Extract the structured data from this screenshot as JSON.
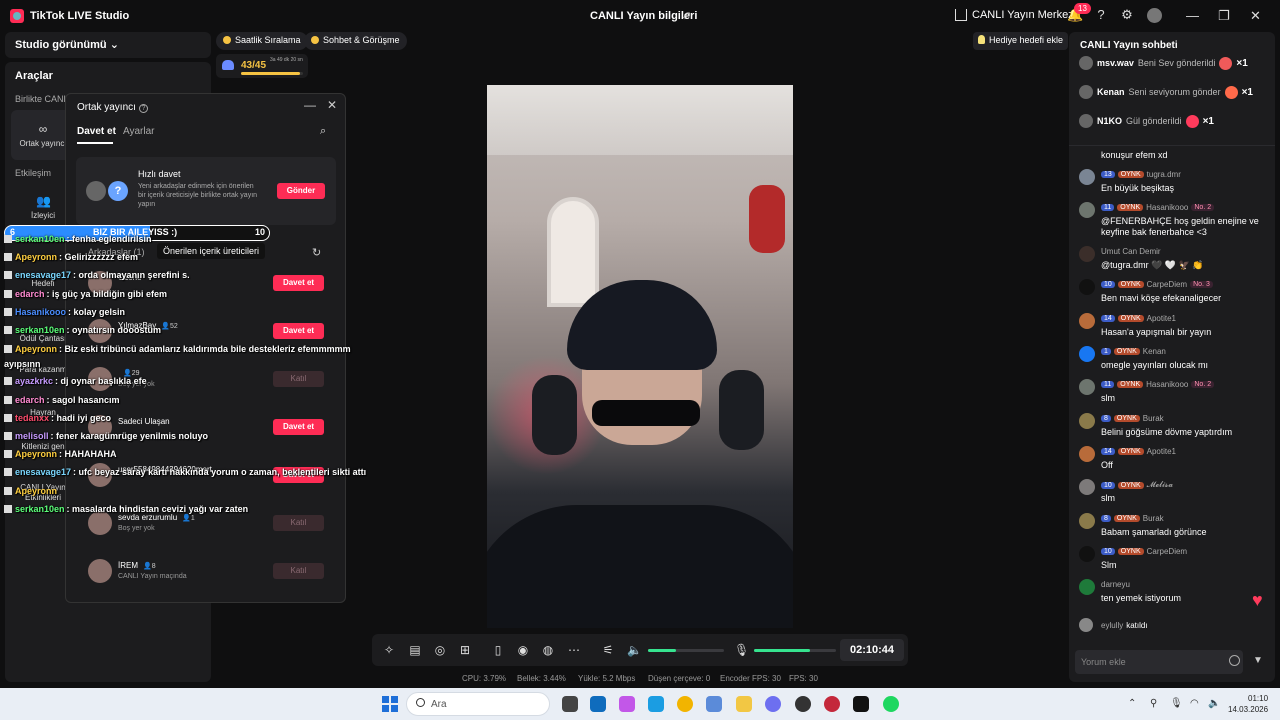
{
  "titlebar": {
    "app_title": "TikTok LIVE Studio",
    "center_title": "CANLI Yayın bilgileri",
    "live_center": "CANLI Yayın Merkezi",
    "notification_count": "13"
  },
  "left": {
    "studio_view": "Studio görünümü",
    "tools_title": "Araçlar",
    "section_together": "Birlikte CANLI",
    "cohost_label": "Ortak yayıncı",
    "section_interaction": "Etkileşim",
    "viewers_label": "İzleyici",
    "items": [
      "Hedefi",
      "Ödül Çantası",
      "Para kazanm",
      "Hayran",
      "Kitlenizi gen",
      "CANLI Yayın",
      "Etkinlikleri"
    ]
  },
  "pills": {
    "hourly_ranking": "Saatlik Sıralama",
    "chat_meet": "Sohbet & Görüşme",
    "gift_goal": "Hediye hedefi ekle"
  },
  "goal": {
    "value": "43/45",
    "timer": "3a 49 dk 20 sn",
    "progress": 0.95
  },
  "popup": {
    "title": "Ortak yayıncı",
    "tab_invite": "Davet et",
    "tab_settings": "Ayarlar",
    "quick_title": "Hızlı davet",
    "quick_desc": "Yeni arkadaşlar edinmek için önerilen bir içerik üreticisiyle birlikte ortak yayın yapın",
    "send_label": "Gönder",
    "section_friends": "Arkadaşlar (1)",
    "section_suggested": "Önerilen içerik üreticileri",
    "rows": [
      {
        "name": "Ozone",
        "followers": "",
        "sub": "",
        "button": "Davet et",
        "active": true
      },
      {
        "name": "YılmazBay",
        "followers": "52",
        "sub": "",
        "button": "Davet et",
        "active": true
      },
      {
        "name": "",
        "followers": "29",
        "sub": "Boş yer yok",
        "button": "Katıl",
        "active": false
      },
      {
        "name": "Sadeci Ulaşan",
        "followers": "",
        "sub": "",
        "button": "Davet et",
        "active": true
      },
      {
        "name": "user55849844394620mert",
        "followers": "",
        "sub": "",
        "button": "Davet et",
        "active": true
      },
      {
        "name": "sevda erzurumlu",
        "followers": "1",
        "sub": "Boş yer yok",
        "button": "Katıl",
        "active": false
      },
      {
        "name": "İREM",
        "followers": "8",
        "sub": "CANLI Yayın maçında",
        "button": "Katıl",
        "active": false
      }
    ]
  },
  "overlay": {
    "bar_left": "6",
    "bar_mid": "BIZ BIR AILEYISS :)",
    "bar_right": "10",
    "lines": [
      {
        "user": "serkan10en",
        "text": ": fenha eglendirilsin",
        "color": "#5cff7a"
      },
      {
        "user": "Apeyronn",
        "text": ": Gelirizzzzzz efem",
        "color": "#ffcf40"
      },
      {
        "user": "enesavage17",
        "text": ": orda olmayanın şerefini s.",
        "color": "#7ad7ff"
      },
      {
        "user": "edarch",
        "text": ": iş güç ya bildiğin gibi efem",
        "color": "#ff8bd1"
      },
      {
        "user": "Hasanikooo",
        "text": ": kolay gelsin",
        "color": "#4a8dff"
      },
      {
        "user": "serkan10en",
        "text": ": oynatırsın dooostum",
        "color": "#5cff7a"
      },
      {
        "user": "Apeyronn",
        "text": ": Biz eski tribüncü adamlarız kaldırımda bile destekleriz efemmmmm",
        "color": "#ffcf40"
      },
      {
        "user": "",
        "text": "ayıpsınn",
        "color": "#ffffff"
      },
      {
        "user": "ayazkrkc",
        "text": ": dj oynar başlıkla efe",
        "color": "#c79bff"
      },
      {
        "user": "edarch",
        "text": ": sagol hasancım",
        "color": "#ff8bd1"
      },
      {
        "user": "tedanxx",
        "text": ": hadi iyi geco",
        "color": "#ff4d6d"
      },
      {
        "user": "melisoll",
        "text": ": fener karagümrüge yenilmis noluyo",
        "color": "#c79bff"
      },
      {
        "user": "Apeyronn",
        "text": ": HAHAHAHA",
        "color": "#ffcf40"
      },
      {
        "user": "enesavage17",
        "text": ": ufc beyaz saray kartı hakkında yorum o zaman, beklentileri sikti attı",
        "color": "#7ad7ff"
      },
      {
        "user": "Apeyronn",
        "text": "",
        "color": "#ffcf40"
      },
      {
        "user": "serkan10en",
        "text": ": masalarda hindistan cevizi yağı var zaten",
        "color": "#5cff7a"
      }
    ]
  },
  "chat": {
    "title": "CANLI Yayın sohbeti",
    "gifts": [
      {
        "user": "msv.wav",
        "text": "Beni Sev gönderildi",
        "count": "×1",
        "color": "#f05a5a"
      },
      {
        "user": "Kenan",
        "text": "Seni seviyorum gönder",
        "count": "×1",
        "color": "#ff6a4a"
      },
      {
        "user": "N1KO",
        "text": "Gül gönderildi",
        "count": "×1",
        "color": "#ff3b5c"
      }
    ],
    "messages": [
      {
        "meta_user": "",
        "level": "",
        "oynk": false,
        "rank": "",
        "text": "konuşur efem xd"
      },
      {
        "meta_user": "tugra.dmr",
        "level": "13",
        "oynk": true,
        "rank": "",
        "text": "En büyük beşiktaş"
      },
      {
        "meta_user": "Hasanikooo",
        "level": "11",
        "oynk": true,
        "rank": "No. 2",
        "text": "@FENERBAHÇE hoş geldin enejine ve keyfine bak fenerbahce <3"
      },
      {
        "meta_user": "Umut Can Demir",
        "level": "",
        "oynk": false,
        "rank": "",
        "text": "@tugra.dmr 🖤 🤍 🦅 👏"
      },
      {
        "meta_user": "CarpeDiem",
        "level": "10",
        "oynk": true,
        "rank": "No. 3",
        "text": "Ben mavi köşe efekanaligecer"
      },
      {
        "meta_user": "Apotite1",
        "level": "14",
        "oynk": true,
        "rank": "",
        "text": "Hasan'a yapışmalı bir yayın"
      },
      {
        "meta_user": "Kenan",
        "level": "1",
        "oynk": true,
        "rank": "",
        "text": "omegle yayınları olucak mı"
      },
      {
        "meta_user": "Hasanikooo",
        "level": "11",
        "oynk": true,
        "rank": "No. 2",
        "text": "slm"
      },
      {
        "meta_user": "Burak",
        "level": "8",
        "oynk": true,
        "rank": "",
        "text": "Belini göğsüme dövme yaptırdım"
      },
      {
        "meta_user": "Apotite1",
        "level": "14",
        "oynk": true,
        "rank": "",
        "text": "Off"
      },
      {
        "meta_user": "𝓜𝓮𝓵𝓲𝓼𝓪",
        "level": "10",
        "oynk": true,
        "rank": "",
        "text": "slm"
      },
      {
        "meta_user": "Burak",
        "level": "8",
        "oynk": true,
        "rank": "",
        "text": "Babam şamarladı görünce"
      },
      {
        "meta_user": "CarpeDiem",
        "level": "10",
        "oynk": true,
        "rank": "",
        "text": "Slm"
      },
      {
        "meta_user": "darneyu",
        "level": "",
        "oynk": false,
        "rank": "",
        "text": "ten yemek istiyorum"
      }
    ],
    "joined_user": "eylully",
    "joined_text": "katıldı",
    "input_placeholder": "Yorum ekle"
  },
  "controls": {
    "timer": "02:10:44",
    "speaker_level": 0.37,
    "mic_level": 0.68
  },
  "stats": {
    "cpu": "CPU:  3.79%",
    "memory": "Bellek:  3.44%",
    "upload": "Yükle:  5.2 Mbps",
    "dropped": "Düşen çerçeve:  0",
    "encoder_fps": "Encoder FPS:  30",
    "fps": "FPS:  30"
  },
  "taskbar": {
    "search_placeholder": "Ara",
    "time": "01:10",
    "date": "14.03.2026"
  },
  "colors": {
    "accent": "#fe2c55",
    "green": "#36e38f",
    "panel": "#1c1c1e"
  }
}
